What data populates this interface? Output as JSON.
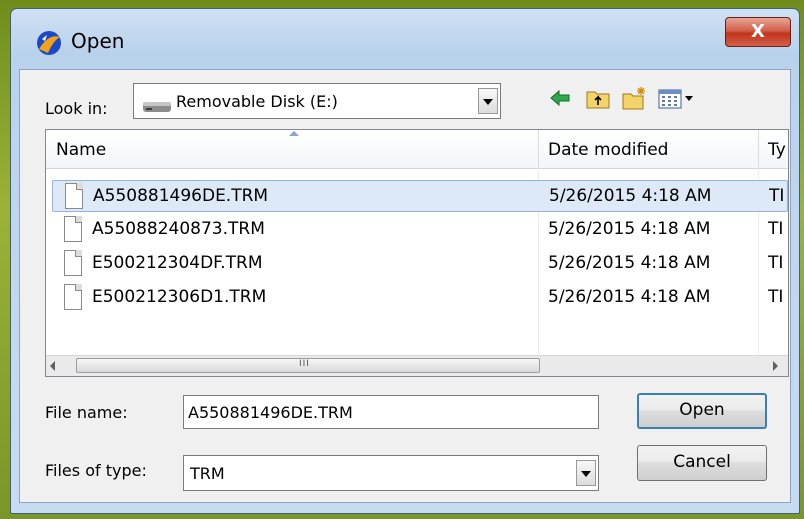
{
  "window": {
    "title": "Open",
    "close_label": "X"
  },
  "lookin": {
    "label": "Look in:",
    "value": "Removable Disk (E:)"
  },
  "toolbar": {
    "icons": [
      "back-arrow-icon",
      "up-folder-icon",
      "new-folder-icon",
      "view-menu-icon"
    ]
  },
  "filelist": {
    "columns": [
      "Name",
      "Date modified",
      "Ty"
    ],
    "rows": [
      {
        "name": "A550881496DE.TRM",
        "date": "5/26/2015 4:18 AM",
        "type": "TI"
      },
      {
        "name": "A55088240873.TRM",
        "date": "5/26/2015 4:18 AM",
        "type": "TI"
      },
      {
        "name": "E500212304DF.TRM",
        "date": "5/26/2015 4:18 AM",
        "type": "TI"
      },
      {
        "name": "E500212306D1.TRM",
        "date": "5/26/2015 4:18 AM",
        "type": "TI"
      }
    ],
    "scroll_grip": "III"
  },
  "form": {
    "filename_label": "File name:",
    "filename_value": "A550881496DE.TRM",
    "filetype_label": "Files of type:",
    "filetype_value": "TRM"
  },
  "buttons": {
    "open": "Open",
    "cancel": "Cancel"
  },
  "colors": {
    "selection": "#dde9f7",
    "close_button": "#c1341c",
    "accent": "#3c7fb1"
  }
}
